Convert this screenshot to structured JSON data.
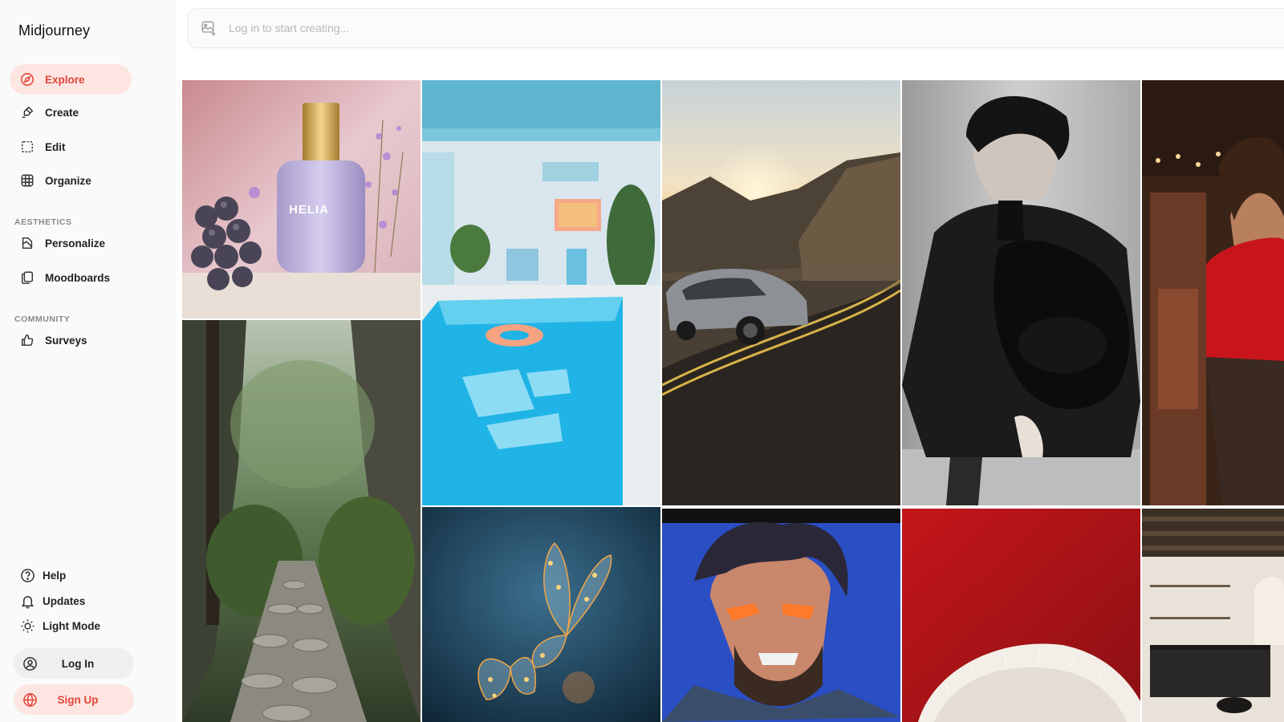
{
  "app": {
    "name": "Midjourney"
  },
  "nav": {
    "items": [
      {
        "id": "explore",
        "label": "Explore",
        "icon": "compass-icon",
        "active": true
      },
      {
        "id": "create",
        "label": "Create",
        "icon": "brush-icon",
        "active": false
      },
      {
        "id": "edit",
        "label": "Edit",
        "icon": "edit-icon",
        "active": false
      },
      {
        "id": "organize",
        "label": "Organize",
        "icon": "grid-icon",
        "active": false
      }
    ],
    "aesthetics_label": "AESTHETICS",
    "aesthetics": [
      {
        "id": "personalize",
        "label": "Personalize",
        "icon": "personalize-icon"
      },
      {
        "id": "moodboards",
        "label": "Moodboards",
        "icon": "moodboard-icon"
      }
    ],
    "community_label": "COMMUNITY",
    "community": [
      {
        "id": "surveys",
        "label": "Surveys",
        "icon": "thumbs-up-icon"
      }
    ]
  },
  "footer": {
    "help": "Help",
    "updates": "Updates",
    "light_mode": "Light Mode",
    "log_in": "Log In",
    "sign_up": "Sign Up"
  },
  "search": {
    "placeholder": "Log in to start creating..."
  },
  "gallery": {
    "perfume_label": "HELIA"
  },
  "colors": {
    "accent": "#e0453a",
    "accent_bg": "#fde6e2",
    "sidebar_bg": "#fafafa"
  }
}
